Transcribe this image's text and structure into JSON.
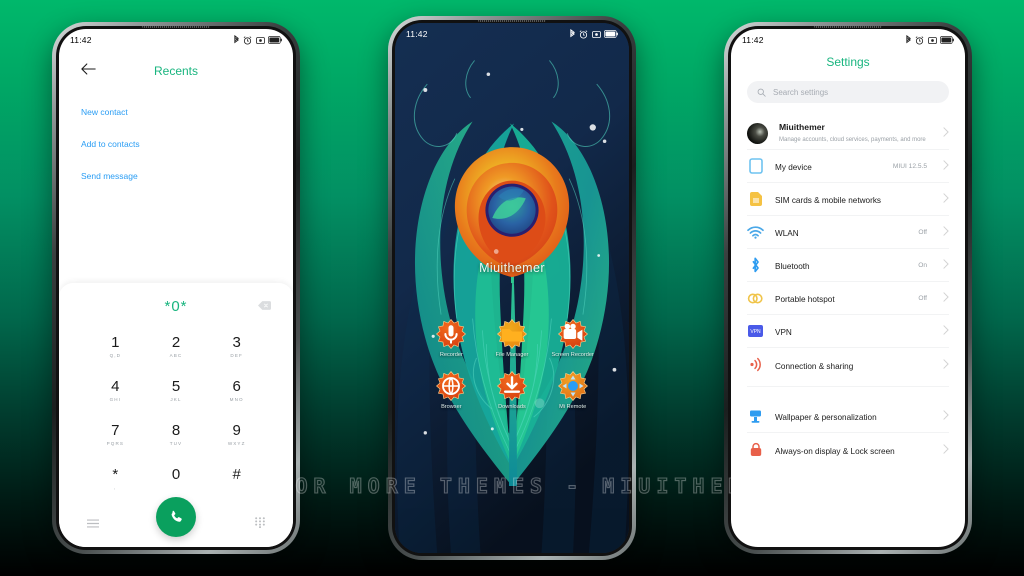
{
  "background": {
    "top_color": "#00b86b",
    "bottom_color": "#000000"
  },
  "watermark": {
    "text": "VISIT FOR MORE THEMES - MIUITHEMER.COM"
  },
  "accent": {
    "green": "#19b57f",
    "call_green": "#0aa05e",
    "link_blue": "#2a9df4"
  },
  "status_bar": {
    "time": "11:42",
    "icons": [
      "bluetooth-icon",
      "alarm-icon",
      "screenshot-icon",
      "battery-icon"
    ]
  },
  "phone1": {
    "name": "dialer-phone",
    "title": "Recents",
    "back_icon": "back-arrow-icon",
    "links": [
      {
        "label": "New contact"
      },
      {
        "label": "Add to contacts"
      },
      {
        "label": "Send message"
      }
    ],
    "dialer": {
      "number": "*0*",
      "backspace_icon": "backspace-icon",
      "keys": [
        {
          "num": "1",
          "letters": "Q,D"
        },
        {
          "num": "2",
          "letters": "ABC"
        },
        {
          "num": "3",
          "letters": "DEF"
        },
        {
          "num": "4",
          "letters": "GHI"
        },
        {
          "num": "5",
          "letters": "JKL"
        },
        {
          "num": "6",
          "letters": "MNO"
        },
        {
          "num": "7",
          "letters": "PQRS"
        },
        {
          "num": "8",
          "letters": "TUV"
        },
        {
          "num": "9",
          "letters": "WXYZ"
        },
        {
          "num": "*",
          "letters": ","
        },
        {
          "num": "0",
          "letters": ""
        },
        {
          "num": "#",
          "letters": ""
        }
      ],
      "nav": {
        "left_icon": "menu-icon",
        "call_icon": "call-icon",
        "right_icon": "keypad-icon"
      }
    }
  },
  "phone2": {
    "name": "home-screen-phone",
    "wallpaper_name": "peacock-feather-wallpaper",
    "wallpaper_colors": {
      "bg_dark": "#12294a",
      "teal": "#1aa89a",
      "green": "#2fc48f",
      "orange": "#e8601f",
      "yellow": "#f0c419",
      "eye_blue": "#2b5fa8"
    },
    "home_label": "Miuithemer",
    "apps": [
      {
        "label": "Recorder",
        "icon": "microphone-icon"
      },
      {
        "label": "File Manager",
        "icon": "folder-icon"
      },
      {
        "label": "Screen Recorder",
        "icon": "video-camera-icon"
      },
      {
        "label": "Browser",
        "icon": "globe-icon"
      },
      {
        "label": "Downloads",
        "icon": "download-arrow-icon"
      },
      {
        "label": "Mi Remote",
        "icon": "remote-control-icon"
      }
    ]
  },
  "phone3": {
    "name": "settings-phone",
    "title": "Settings",
    "search": {
      "placeholder": "Search settings",
      "icon": "search-icon"
    },
    "account": {
      "name": "Miuithemer",
      "subtitle": "Manage accounts, cloud services, payments, and more",
      "avatar": "avatar"
    },
    "rows": [
      {
        "label": "My device",
        "value": "MIUI 12.5.5",
        "icon": "device-icon",
        "icon_color": "#6fc3f0"
      },
      {
        "label": "SIM cards & mobile networks",
        "value": "",
        "icon": "sim-card-icon",
        "icon_color": "#f5c243"
      },
      {
        "label": "WLAN",
        "value": "Off",
        "icon": "wifi-icon",
        "icon_color": "#4aa8e8"
      },
      {
        "label": "Bluetooth",
        "value": "On",
        "icon": "bluetooth-icon",
        "icon_color": "#2e9cf0"
      },
      {
        "label": "Portable hotspot",
        "value": "Off",
        "icon": "hotspot-icon",
        "icon_color": "#f0c44a"
      },
      {
        "label": "VPN",
        "value": "",
        "icon": "vpn-icon",
        "icon_color": "#4a5ae8"
      },
      {
        "label": "Connection & sharing",
        "value": "",
        "icon": "connection-sharing-icon",
        "icon_color": "#e8604a"
      }
    ],
    "rows2": [
      {
        "label": "Wallpaper & personalization",
        "value": "",
        "icon": "wallpaper-icon",
        "icon_color": "#2e9cf0"
      },
      {
        "label": "Always-on display & Lock screen",
        "value": "",
        "icon": "lock-icon",
        "icon_color": "#e8604a"
      }
    ]
  }
}
